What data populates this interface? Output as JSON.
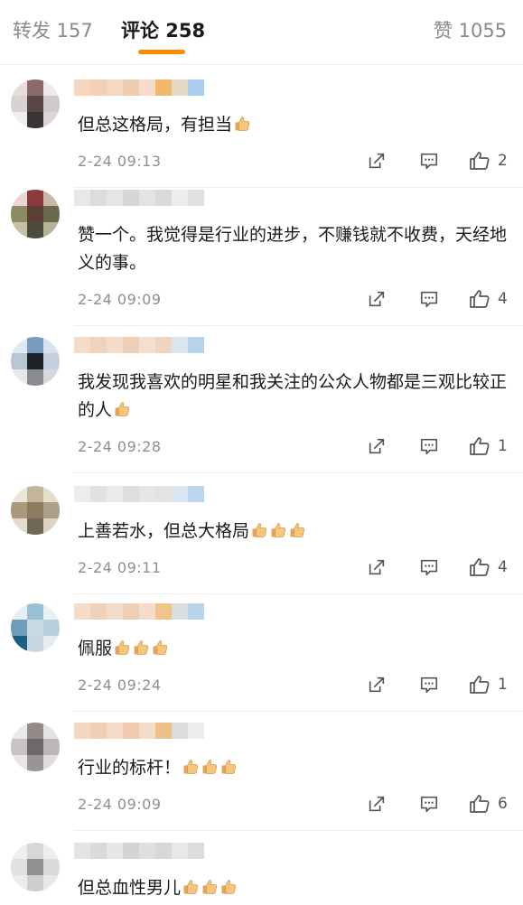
{
  "tabs": [
    {
      "label": "转发 157"
    },
    {
      "label": "评论 258"
    },
    {
      "label": "赞 1055"
    }
  ],
  "comments": [
    {
      "text": "但总这格局，有担当",
      "thumbs": 1,
      "time": "2-24 09:13",
      "likes": "2"
    },
    {
      "text": "赞一个。我觉得是行业的进步，不赚钱就不收费，天经地义的事。",
      "thumbs": 0,
      "time": "2-24 09:09",
      "likes": "4"
    },
    {
      "text": "我发现我喜欢的明星和我关注的公众人物都是三观比较正的人",
      "thumbs": 1,
      "time": "2-24 09:28",
      "likes": "1"
    },
    {
      "text": "上善若水，但总大格局",
      "thumbs": 3,
      "time": "2-24 09:11",
      "likes": "4"
    },
    {
      "text": "佩服",
      "thumbs": 3,
      "time": "2-24 09:24",
      "likes": "1"
    },
    {
      "text": "行业的标杆！",
      "thumbs": 3,
      "time": "2-24 09:09",
      "likes": "6"
    },
    {
      "text": "但总血性男儿",
      "thumbs": 3,
      "time": "",
      "likes": ""
    }
  ],
  "icons": {
    "share": "share-icon",
    "reply": "comment-icon",
    "like": "thumbs-up-icon",
    "emoji": "thumbs-up-emoji-icon"
  },
  "colors": {
    "accent": "#ff8a00",
    "muted_text": "#8e8e8e"
  }
}
